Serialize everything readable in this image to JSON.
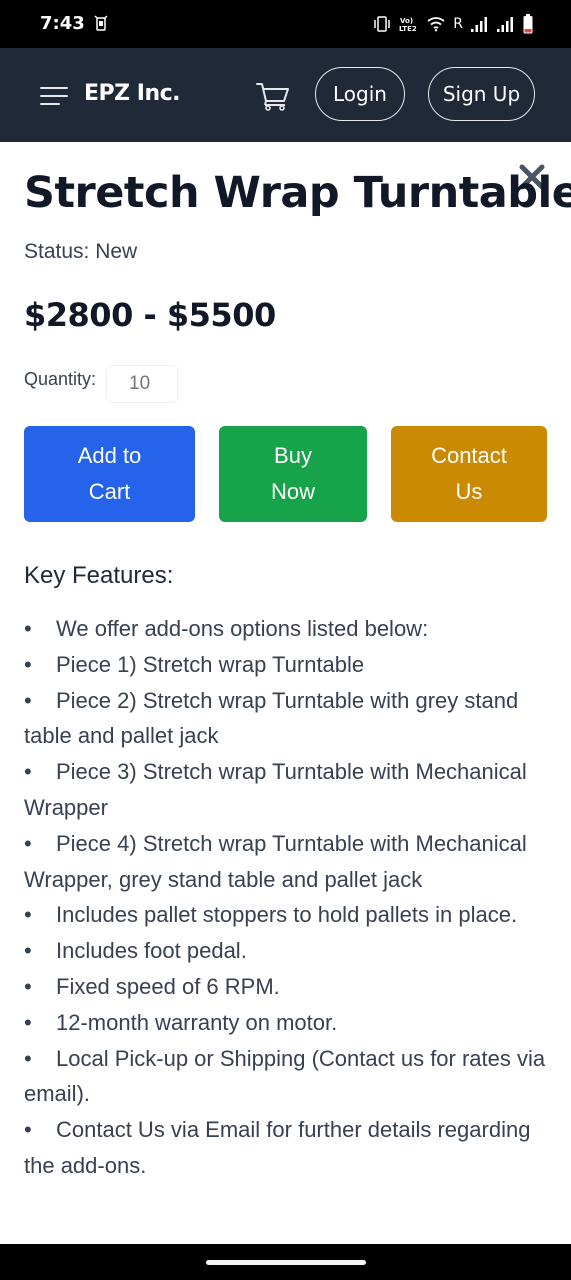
{
  "status_bar": {
    "time": "7:43",
    "carrier_indicator": "R",
    "icons": [
      "notification-icon",
      "vibrate-icon",
      "volte-icon",
      "wifi-icon",
      "signal-icon",
      "signal-icon",
      "battery-icon"
    ],
    "volte_text": "Vo) LTE2"
  },
  "header": {
    "brand": "EPZ Inc.",
    "login_label": "Login",
    "signup_label": "Sign Up",
    "menu_icon": "hamburger-icon",
    "cart_icon": "cart-icon",
    "background": "#1f2937"
  },
  "product": {
    "title": "Stretch Wrap Turntable",
    "status": "Status: New",
    "price": "$2800 - $5500",
    "quantity_label": "Quantity:",
    "quantity_placeholder": "10",
    "close_icon": "close-icon"
  },
  "actions": {
    "add_to_cart": [
      "Add to",
      "Cart"
    ],
    "buy_now": [
      "Buy",
      "Now"
    ],
    "contact_us": [
      "Contact",
      "Us"
    ],
    "colors": {
      "add_to_cart": "#2563eb",
      "buy_now": "#16a34a",
      "contact_us": "#ca8a04"
    }
  },
  "features": {
    "heading": "Key Features:",
    "bullet": "•",
    "items": [
      "We offer add-ons options listed below:",
      "Piece 1) Stretch wrap Turntable",
      "Piece 2) Stretch wrap Turntable with grey stand table and pallet jack",
      "Piece 3) Stretch wrap Turntable with Mechanical Wrapper",
      "Piece 4) Stretch wrap Turntable with Mechanical Wrapper, grey stand table and pallet jack",
      "Includes pallet stoppers to hold pallets in place.",
      "Includes foot pedal.",
      "Fixed speed of 6 RPM.",
      "12-month warranty on motor.",
      "Local Pick-up or Shipping (Contact us for rates via email).",
      "Contact Us via Email for further details regarding the add-ons."
    ]
  }
}
